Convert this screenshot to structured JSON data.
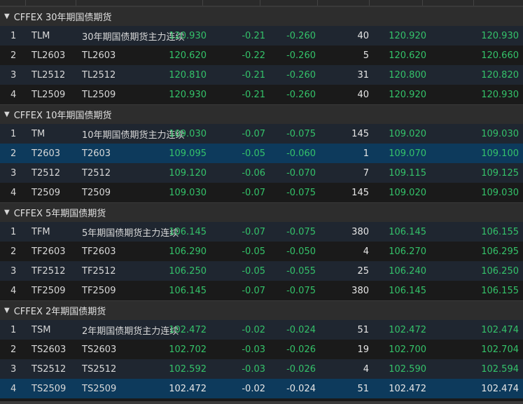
{
  "groups": [
    {
      "title": "CFFEX 30年期国债期货",
      "rows": [
        {
          "idx": "1",
          "code": "TLM",
          "name": "30年期国债期货主力连续",
          "price": "120.930",
          "chg": "-0.21",
          "pct": "-0.260",
          "vol": "40",
          "bid": "120.920",
          "ask": "120.930"
        },
        {
          "idx": "2",
          "code": "TL2603",
          "name": "TL2603",
          "price": "120.620",
          "chg": "-0.22",
          "pct": "-0.260",
          "vol": "5",
          "bid": "120.620",
          "ask": "120.660"
        },
        {
          "idx": "3",
          "code": "TL2512",
          "name": "TL2512",
          "price": "120.810",
          "chg": "-0.21",
          "pct": "-0.260",
          "vol": "31",
          "bid": "120.800",
          "ask": "120.820"
        },
        {
          "idx": "4",
          "code": "TL2509",
          "name": "TL2509",
          "price": "120.930",
          "chg": "-0.21",
          "pct": "-0.260",
          "vol": "40",
          "bid": "120.920",
          "ask": "120.930"
        }
      ]
    },
    {
      "title": "CFFEX 10年期国债期货",
      "rows": [
        {
          "idx": "1",
          "code": "TM",
          "name": "10年期国债期货主力连续",
          "price": "109.030",
          "chg": "-0.07",
          "pct": "-0.075",
          "vol": "145",
          "bid": "109.020",
          "ask": "109.030"
        },
        {
          "idx": "2",
          "code": "T2603",
          "name": "T2603",
          "price": "109.095",
          "chg": "-0.05",
          "pct": "-0.060",
          "vol": "1",
          "bid": "109.070",
          "ask": "109.100"
        },
        {
          "idx": "3",
          "code": "T2512",
          "name": "T2512",
          "price": "109.120",
          "chg": "-0.06",
          "pct": "-0.070",
          "vol": "7",
          "bid": "109.115",
          "ask": "109.125"
        },
        {
          "idx": "4",
          "code": "T2509",
          "name": "T2509",
          "price": "109.030",
          "chg": "-0.07",
          "pct": "-0.075",
          "vol": "145",
          "bid": "109.020",
          "ask": "109.030"
        }
      ]
    },
    {
      "title": "CFFEX 5年期国债期货",
      "rows": [
        {
          "idx": "1",
          "code": "TFM",
          "name": "5年期国债期货主力连续",
          "price": "106.145",
          "chg": "-0.07",
          "pct": "-0.075",
          "vol": "380",
          "bid": "106.145",
          "ask": "106.155"
        },
        {
          "idx": "2",
          "code": "TF2603",
          "name": "TF2603",
          "price": "106.290",
          "chg": "-0.05",
          "pct": "-0.050",
          "vol": "4",
          "bid": "106.270",
          "ask": "106.295"
        },
        {
          "idx": "3",
          "code": "TF2512",
          "name": "TF2512",
          "price": "106.250",
          "chg": "-0.05",
          "pct": "-0.055",
          "vol": "25",
          "bid": "106.240",
          "ask": "106.250"
        },
        {
          "idx": "4",
          "code": "TF2509",
          "name": "TF2509",
          "price": "106.145",
          "chg": "-0.07",
          "pct": "-0.075",
          "vol": "380",
          "bid": "106.145",
          "ask": "106.155"
        }
      ]
    },
    {
      "title": "CFFEX 2年期国债期货",
      "rows": [
        {
          "idx": "1",
          "code": "TSM",
          "name": "2年期国债期货主力连续",
          "price": "102.472",
          "chg": "-0.02",
          "pct": "-0.024",
          "vol": "51",
          "bid": "102.472",
          "ask": "102.474"
        },
        {
          "idx": "2",
          "code": "TS2603",
          "name": "TS2603",
          "price": "102.702",
          "chg": "-0.03",
          "pct": "-0.026",
          "vol": "19",
          "bid": "102.700",
          "ask": "102.704"
        },
        {
          "idx": "3",
          "code": "TS2512",
          "name": "TS2512",
          "price": "102.592",
          "chg": "-0.03",
          "pct": "-0.026",
          "vol": "4",
          "bid": "102.590",
          "ask": "102.594"
        },
        {
          "idx": "4",
          "code": "TS2509",
          "name": "TS2509",
          "price": "102.472",
          "chg": "-0.02",
          "pct": "-0.024",
          "vol": "51",
          "bid": "102.472",
          "ask": "102.474"
        }
      ]
    }
  ],
  "selection": [
    {
      "group": 1,
      "row": 1,
      "green": true
    },
    {
      "group": 3,
      "row": 3,
      "green": false
    }
  ],
  "colors": {
    "up_down_value": "#34c26a",
    "selected_row": "#0d3a5c",
    "background": "#1a1a1a",
    "alt_row": "#1f2630"
  },
  "icons": {
    "group_toggle": "triangle-down-icon"
  }
}
